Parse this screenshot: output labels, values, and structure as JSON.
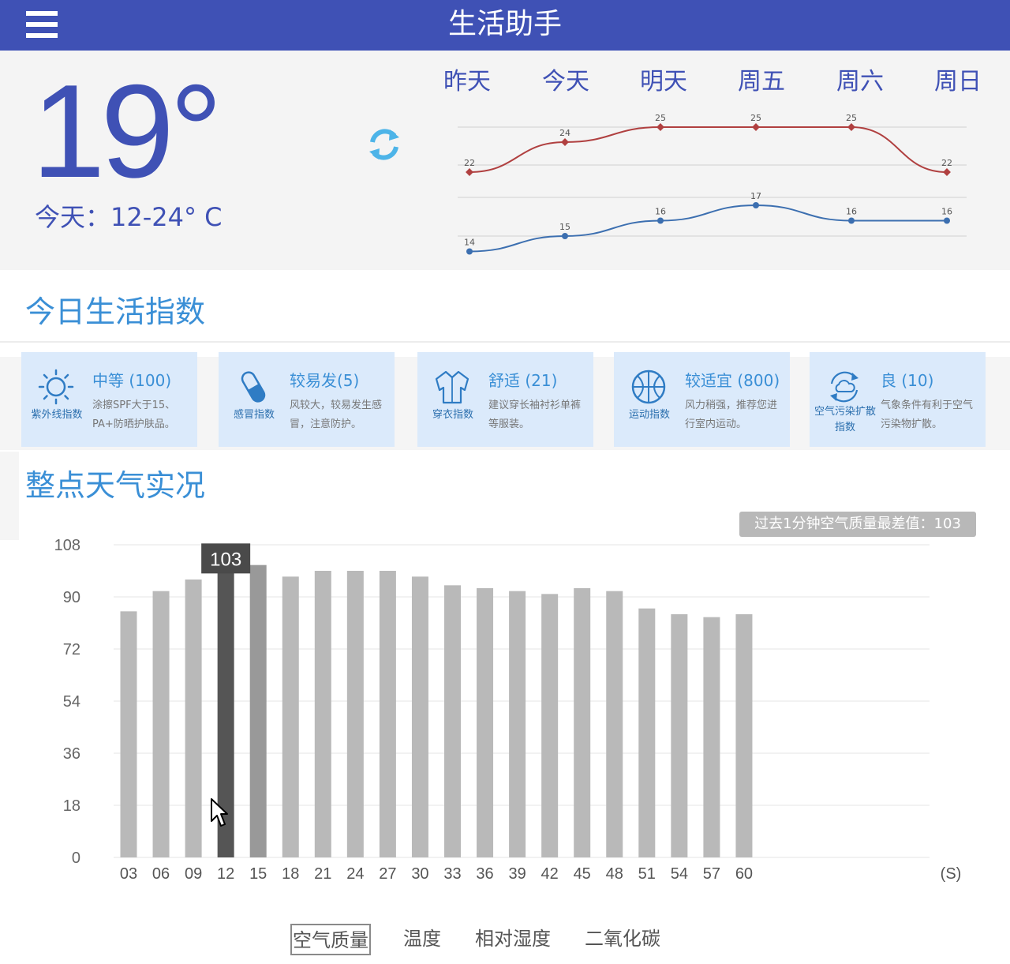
{
  "header": {
    "title": "生活助手"
  },
  "current": {
    "temperature": "19°",
    "range_text": "今天：12-24° C"
  },
  "forecast": {
    "days": [
      "昨天",
      "今天",
      "明天",
      "周五",
      "周六",
      "周日"
    ],
    "highs": [
      22,
      24,
      25,
      25,
      25,
      22
    ],
    "lows": [
      14,
      15,
      16,
      17,
      16,
      16
    ],
    "high_color": "#b04040",
    "low_color": "#3c6fb0"
  },
  "life_index": {
    "title": "今日生活指数",
    "cards": [
      {
        "icon": "sun-icon",
        "caption": "紫外线指数",
        "value": "中等 (100)",
        "desc": "涂擦SPF大于15、PA+防晒护肤品。"
      },
      {
        "icon": "pill-icon",
        "caption": "感冒指数",
        "value": "较易发(5)",
        "desc": "风较大，较易发生感冒，注意防护。"
      },
      {
        "icon": "shirt-icon",
        "caption": "穿衣指数",
        "value": "舒适 (21)",
        "desc": "建议穿长袖衬衫单裤等服装。"
      },
      {
        "icon": "ball-icon",
        "caption": "运动指数",
        "value": "较适宜 (800)",
        "desc": "风力稍强，推荐您进行室内运动。"
      },
      {
        "icon": "cloud-cycle-icon",
        "caption": "空气污染扩散指数",
        "value": "良 (10)",
        "desc": "气象条件有利于空气污染物扩散。"
      }
    ]
  },
  "hourly": {
    "title": "整点天气实况",
    "worst_badge": "过去1分钟空气质量最差值：103",
    "tooltip": "103",
    "tabs": [
      "空气质量",
      "温度",
      "相对湿度",
      "二氧化碳"
    ],
    "active_tab": 0
  },
  "chart_data": {
    "type": "bar",
    "categories": [
      "03",
      "06",
      "09",
      "12",
      "15",
      "18",
      "21",
      "24",
      "27",
      "30",
      "33",
      "36",
      "39",
      "42",
      "45",
      "48",
      "51",
      "54",
      "57",
      "60"
    ],
    "values": [
      85,
      92,
      96,
      103,
      101,
      97,
      99,
      99,
      99,
      97,
      94,
      93,
      92,
      91,
      93,
      92,
      86,
      84,
      83,
      84
    ],
    "y_ticks": [
      0,
      18,
      36,
      54,
      72,
      90,
      108
    ],
    "ylim": [
      0,
      108
    ],
    "x_unit": "(S)",
    "highlight_index": 3,
    "bar_color": "#b9b9b9",
    "highlight_color": "#555555",
    "hover_color": "#999999"
  }
}
